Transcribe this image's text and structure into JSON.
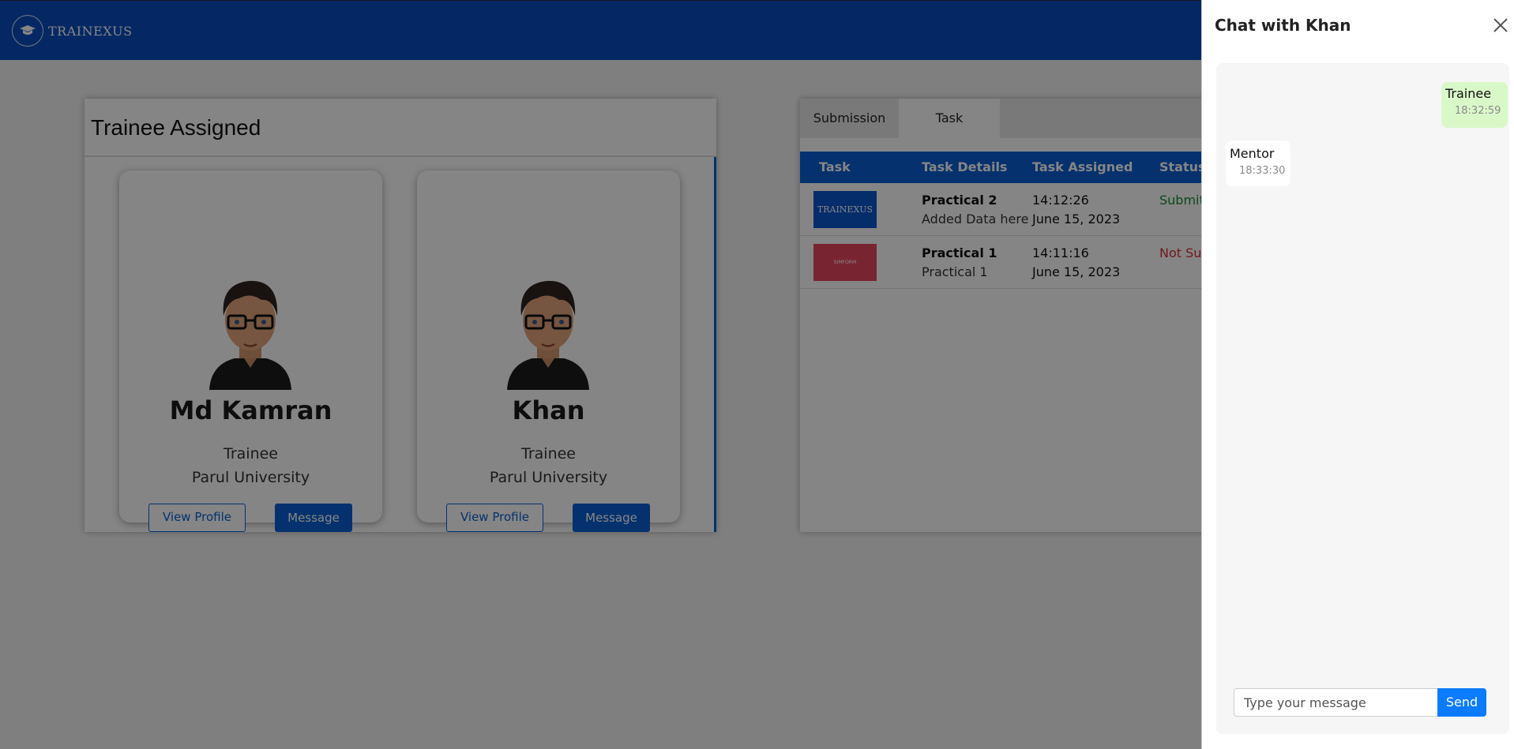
{
  "header": {
    "brand": "TRAINEXUS",
    "logo_icon": "graduation-cap-icon"
  },
  "assigned": {
    "title": "Trainee Assigned",
    "cards": [
      {
        "name": "Md Kamran",
        "role": "Trainee",
        "university": "Parul University",
        "view_label": "View Profile",
        "message_label": "Message"
      },
      {
        "name": "Khan",
        "role": "Trainee",
        "university": "Parul University",
        "view_label": "View Profile",
        "message_label": "Message"
      }
    ]
  },
  "tasks": {
    "tabs": [
      "Submission",
      "Task"
    ],
    "active_tab": "Task",
    "headers": [
      "Task",
      "Task Details",
      "Task Assigned",
      "Status"
    ],
    "rows": [
      {
        "thumb_text": "TRAINEXUS",
        "title": "Practical 2",
        "detail": "Added Data here",
        "time": "14:12:26",
        "date": "June 15, 2023",
        "status": "Submitt",
        "status_color": "#1e8a3c"
      },
      {
        "thumb_text": "SIMFORM",
        "title": "Practical 1",
        "detail": "Practical 1",
        "time": "14:11:16",
        "date": "June 15, 2023",
        "status": "Not Sub",
        "status_color": "#d92f3a"
      }
    ]
  },
  "chat": {
    "title": "Chat with Khan",
    "messages": [
      {
        "text": "Trainee",
        "time": "18:32:59",
        "direction": "outgoing"
      },
      {
        "text": "Mentor",
        "time": "18:33:30",
        "direction": "incoming"
      }
    ],
    "input_placeholder": "Type your message",
    "send_label": "Send"
  },
  "colors": {
    "primary": "#0a60d4",
    "header": "#0a4ec0",
    "send": "#0b7bff",
    "outgoing_bubble": "#d9f8c8"
  }
}
